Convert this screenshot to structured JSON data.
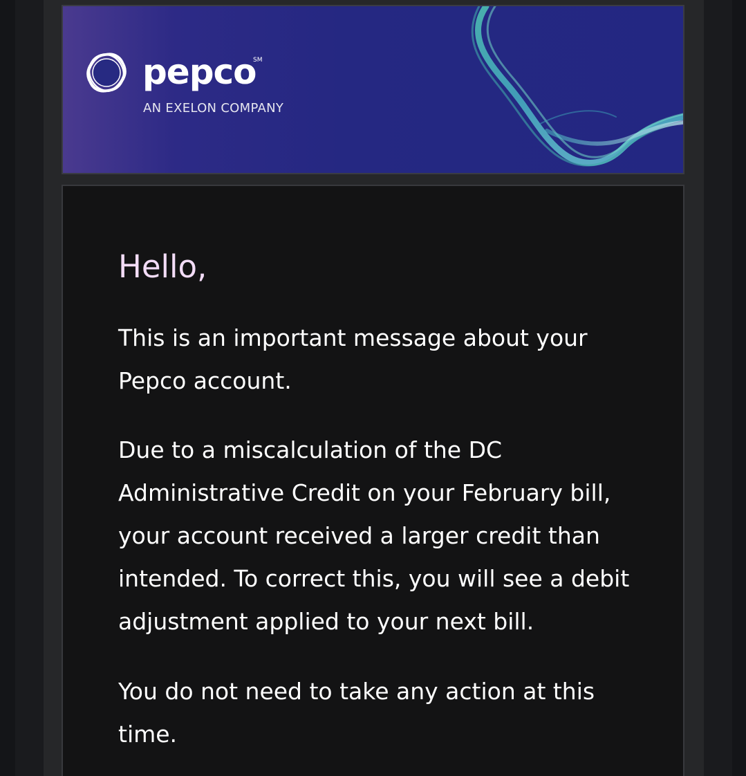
{
  "header": {
    "brand_name": "pepco",
    "trademark": "SM",
    "tagline": "AN EXELON COMPANY"
  },
  "message": {
    "greeting": "Hello,",
    "paragraphs": [
      "This is an important message about your Pepco account.",
      "Due to a miscalculation of the DC Administrative Credit on your February bill, your account received a larger credit than intended. To correct this, you will see a debit adjustment applied to your next bill.",
      "You do not need to take any action at this time."
    ]
  },
  "colors": {
    "banner_background": "#252882",
    "banner_accent": "#5fd0c0",
    "greeting_text": "#f3dcf7",
    "body_text": "#ffffff",
    "content_background": "#131314"
  },
  "icons": {
    "logo": "pepco-logo-icon"
  }
}
